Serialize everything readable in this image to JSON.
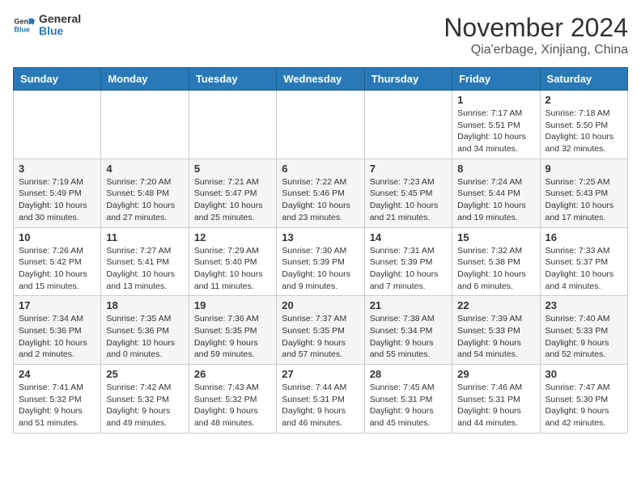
{
  "logo": {
    "line1": "General",
    "line2": "Blue"
  },
  "title": "November 2024",
  "location": "Qia'erbage, Xinjiang, China",
  "weekdays": [
    "Sunday",
    "Monday",
    "Tuesday",
    "Wednesday",
    "Thursday",
    "Friday",
    "Saturday"
  ],
  "weeks": [
    [
      {
        "day": "",
        "info": ""
      },
      {
        "day": "",
        "info": ""
      },
      {
        "day": "",
        "info": ""
      },
      {
        "day": "",
        "info": ""
      },
      {
        "day": "",
        "info": ""
      },
      {
        "day": "1",
        "info": "Sunrise: 7:17 AM\nSunset: 5:51 PM\nDaylight: 10 hours\nand 34 minutes."
      },
      {
        "day": "2",
        "info": "Sunrise: 7:18 AM\nSunset: 5:50 PM\nDaylight: 10 hours\nand 32 minutes."
      }
    ],
    [
      {
        "day": "3",
        "info": "Sunrise: 7:19 AM\nSunset: 5:49 PM\nDaylight: 10 hours\nand 30 minutes."
      },
      {
        "day": "4",
        "info": "Sunrise: 7:20 AM\nSunset: 5:48 PM\nDaylight: 10 hours\nand 27 minutes."
      },
      {
        "day": "5",
        "info": "Sunrise: 7:21 AM\nSunset: 5:47 PM\nDaylight: 10 hours\nand 25 minutes."
      },
      {
        "day": "6",
        "info": "Sunrise: 7:22 AM\nSunset: 5:46 PM\nDaylight: 10 hours\nand 23 minutes."
      },
      {
        "day": "7",
        "info": "Sunrise: 7:23 AM\nSunset: 5:45 PM\nDaylight: 10 hours\nand 21 minutes."
      },
      {
        "day": "8",
        "info": "Sunrise: 7:24 AM\nSunset: 5:44 PM\nDaylight: 10 hours\nand 19 minutes."
      },
      {
        "day": "9",
        "info": "Sunrise: 7:25 AM\nSunset: 5:43 PM\nDaylight: 10 hours\nand 17 minutes."
      }
    ],
    [
      {
        "day": "10",
        "info": "Sunrise: 7:26 AM\nSunset: 5:42 PM\nDaylight: 10 hours\nand 15 minutes."
      },
      {
        "day": "11",
        "info": "Sunrise: 7:27 AM\nSunset: 5:41 PM\nDaylight: 10 hours\nand 13 minutes."
      },
      {
        "day": "12",
        "info": "Sunrise: 7:29 AM\nSunset: 5:40 PM\nDaylight: 10 hours\nand 11 minutes."
      },
      {
        "day": "13",
        "info": "Sunrise: 7:30 AM\nSunset: 5:39 PM\nDaylight: 10 hours\nand 9 minutes."
      },
      {
        "day": "14",
        "info": "Sunrise: 7:31 AM\nSunset: 5:39 PM\nDaylight: 10 hours\nand 7 minutes."
      },
      {
        "day": "15",
        "info": "Sunrise: 7:32 AM\nSunset: 5:38 PM\nDaylight: 10 hours\nand 6 minutes."
      },
      {
        "day": "16",
        "info": "Sunrise: 7:33 AM\nSunset: 5:37 PM\nDaylight: 10 hours\nand 4 minutes."
      }
    ],
    [
      {
        "day": "17",
        "info": "Sunrise: 7:34 AM\nSunset: 5:36 PM\nDaylight: 10 hours\nand 2 minutes."
      },
      {
        "day": "18",
        "info": "Sunrise: 7:35 AM\nSunset: 5:36 PM\nDaylight: 10 hours\nand 0 minutes."
      },
      {
        "day": "19",
        "info": "Sunrise: 7:36 AM\nSunset: 5:35 PM\nDaylight: 9 hours\nand 59 minutes."
      },
      {
        "day": "20",
        "info": "Sunrise: 7:37 AM\nSunset: 5:35 PM\nDaylight: 9 hours\nand 57 minutes."
      },
      {
        "day": "21",
        "info": "Sunrise: 7:38 AM\nSunset: 5:34 PM\nDaylight: 9 hours\nand 55 minutes."
      },
      {
        "day": "22",
        "info": "Sunrise: 7:39 AM\nSunset: 5:33 PM\nDaylight: 9 hours\nand 54 minutes."
      },
      {
        "day": "23",
        "info": "Sunrise: 7:40 AM\nSunset: 5:33 PM\nDaylight: 9 hours\nand 52 minutes."
      }
    ],
    [
      {
        "day": "24",
        "info": "Sunrise: 7:41 AM\nSunset: 5:32 PM\nDaylight: 9 hours\nand 51 minutes."
      },
      {
        "day": "25",
        "info": "Sunrise: 7:42 AM\nSunset: 5:32 PM\nDaylight: 9 hours\nand 49 minutes."
      },
      {
        "day": "26",
        "info": "Sunrise: 7:43 AM\nSunset: 5:32 PM\nDaylight: 9 hours\nand 48 minutes."
      },
      {
        "day": "27",
        "info": "Sunrise: 7:44 AM\nSunset: 5:31 PM\nDaylight: 9 hours\nand 46 minutes."
      },
      {
        "day": "28",
        "info": "Sunrise: 7:45 AM\nSunset: 5:31 PM\nDaylight: 9 hours\nand 45 minutes."
      },
      {
        "day": "29",
        "info": "Sunrise: 7:46 AM\nSunset: 5:31 PM\nDaylight: 9 hours\nand 44 minutes."
      },
      {
        "day": "30",
        "info": "Sunrise: 7:47 AM\nSunset: 5:30 PM\nDaylight: 9 hours\nand 42 minutes."
      }
    ]
  ]
}
